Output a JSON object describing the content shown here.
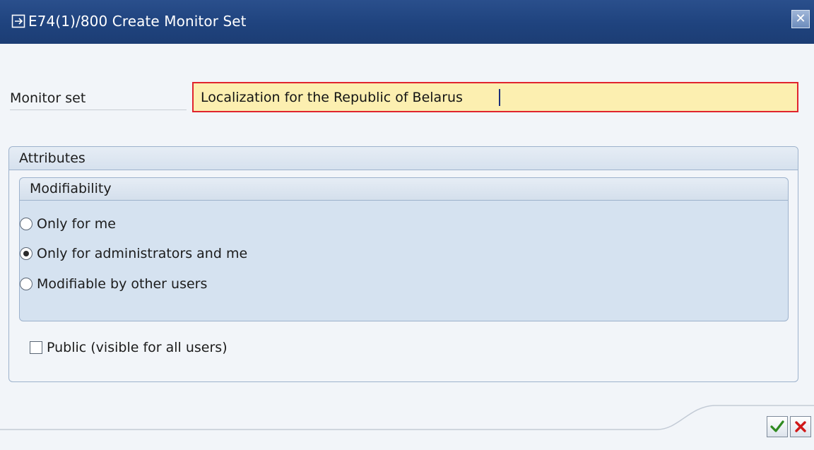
{
  "window": {
    "title": "E74(1)/800 Create Monitor Set",
    "close_icon": "close-icon"
  },
  "form": {
    "monitor_set_label": "Monitor set",
    "monitor_set_value": "Localization for the Republic of Belarus"
  },
  "attributes": {
    "title": "Attributes",
    "modifiability": {
      "title": "Modifiability",
      "options": [
        {
          "label": "Only for me",
          "selected": false
        },
        {
          "label": "Only for administrators and me",
          "selected": true
        },
        {
          "label": "Modifiable by other users",
          "selected": false
        }
      ]
    },
    "public_label": "Public (visible for all users)",
    "public_checked": false
  },
  "footer": {
    "confirm_icon": "checkmark-icon",
    "cancel_icon": "cancel-icon"
  },
  "colors": {
    "titlebar": "#1f437e",
    "input_bg": "#fcefb0",
    "input_border": "#e0242e",
    "group_bg": "#d5e2f0"
  }
}
